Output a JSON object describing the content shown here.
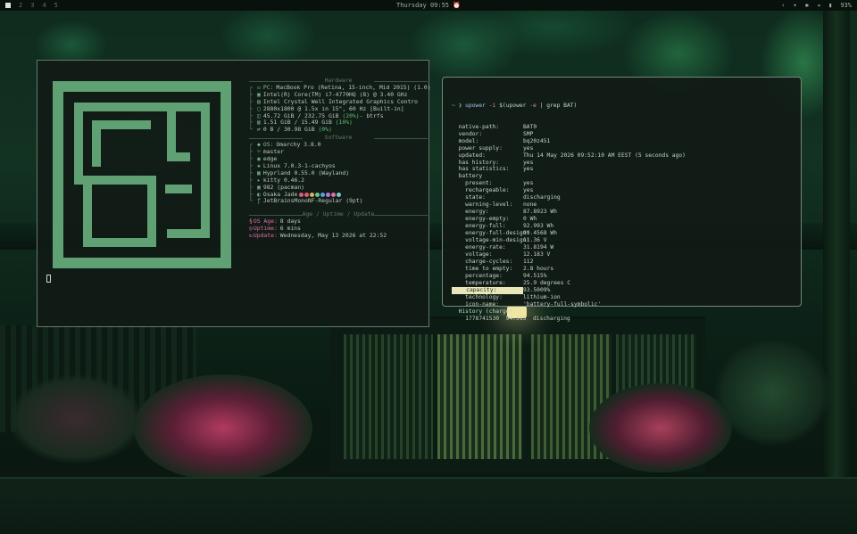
{
  "topbar": {
    "workspaces": [
      "2",
      "3",
      "4",
      "5"
    ],
    "clock": "Thursday 09:55",
    "clock_icon": "alarm-icon",
    "battery": "93%"
  },
  "fastfetch": {
    "hardware_title": "Hardware",
    "software_title": "Software",
    "age_title": "Age / Uptime / Update",
    "hardware": [
      {
        "label": "PC:",
        "value": "MacBook Pro (Retina, 15-inch, Mid 2015) (1.0)"
      },
      {
        "label": "",
        "value": "Intel(R) Core(TM) i7-4770HQ (8) @ 3.40 GHz"
      },
      {
        "label": "",
        "value": "Intel Crystal Well Integrated Graphics Contro"
      },
      {
        "label": "",
        "value": "2880x1800 @ 1.5x in 15\", 60 Hz [Built-in]"
      },
      {
        "label": "",
        "value": "45.72 GiB / 232.75 GiB",
        "pct": "(20%)",
        "tail": " - btrfs"
      },
      {
        "label": "",
        "value": "1.51 GiB / 15.49 GiB",
        "pct": "(10%)",
        "tail": ""
      },
      {
        "label": "",
        "value": "0 B / 30.98 GiB",
        "pct": "(0%)",
        "tail": ""
      }
    ],
    "software": [
      {
        "label": "OS:",
        "value": "Omarchy 3.8.0"
      },
      {
        "label": "",
        "value": "master"
      },
      {
        "label": "",
        "value": "edge"
      },
      {
        "label": "",
        "value": "Linux 7.0.3-1-cachyos"
      },
      {
        "label": "",
        "value": "Hyprland 0.55.0 (Wayland)"
      },
      {
        "label": "",
        "value": "kitty 0.46.2"
      },
      {
        "label": "",
        "value": "982 (pacman)"
      },
      {
        "label": "",
        "value": "Osaka Jade"
      },
      {
        "label": "",
        "value": "JetBrainsMonoNF-Regular (9pt)"
      }
    ],
    "theme_dot_colors": [
      "#e25a7a",
      "#e25a7a",
      "#d8b35b",
      "#6cc28a",
      "#5aa0d8",
      "#b07ad8",
      "#e06fa8",
      "#7ac7c4"
    ],
    "age": {
      "os_age_label": "OS Age:",
      "os_age": "8 days",
      "uptime_label": "Uptime:",
      "uptime": "6 mins",
      "update_label": "Update:",
      "update": "Wednesday, May 13 2026 at 22:52"
    }
  },
  "terminal": {
    "prompt": "~ ❯",
    "cmd_kw": "upower",
    "cmd_flag_i": "-i",
    "cmd_sub_open": "$(upower",
    "cmd_flag_e": "-e",
    "cmd_pipe": "| grep BAT)",
    "lines": [
      {
        "k": "  native-path:",
        "v": "BAT0"
      },
      {
        "k": "  vendor:",
        "v": "SMP"
      },
      {
        "k": "  model:",
        "v": "bq20z451"
      },
      {
        "k": "  power supply:",
        "v": "yes"
      },
      {
        "k": "  updated:",
        "v": "Thu 14 May 2026 09:52:10 AM EEST (5 seconds ago)"
      },
      {
        "k": "  has history:",
        "v": "yes"
      },
      {
        "k": "  has statistics:",
        "v": "yes"
      },
      {
        "k": "  battery",
        "v": ""
      },
      {
        "k": "    present:",
        "v": "yes"
      },
      {
        "k": "    rechargeable:",
        "v": "yes"
      },
      {
        "k": "    state:",
        "v": "discharging"
      },
      {
        "k": "    warning-level:",
        "v": "none"
      },
      {
        "k": "    energy:",
        "v": "87.8923 Wh"
      },
      {
        "k": "    energy-empty:",
        "v": "0 Wh"
      },
      {
        "k": "    energy-full:",
        "v": "92.993 Wh"
      },
      {
        "k": "    energy-full-design:",
        "v": "99.4568 Wh"
      },
      {
        "k": "    voltage-min-design:",
        "v": "11.36 V"
      },
      {
        "k": "    energy-rate:",
        "v": "31.8194 W"
      },
      {
        "k": "    voltage:",
        "v": "12.183 V"
      },
      {
        "k": "    charge-cycles:",
        "v": "112"
      },
      {
        "k": "    time to empty:",
        "v": "2.8 hours"
      },
      {
        "k": "    percentage:",
        "v": "94.515%"
      },
      {
        "k": "    temperature:",
        "v": "25.9 degrees C"
      },
      {
        "k": "    capacity:",
        "v": "93.5009%",
        "highlight": true
      },
      {
        "k": "    technology:",
        "v": "lithium-ion"
      },
      {
        "k": "    icon-name:",
        "v": "'battery-full-symbolic'"
      },
      {
        "k": "  History (charge):",
        "v": ""
      },
      {
        "k": "    1778741530  94.515  discharging",
        "v": ""
      }
    ]
  }
}
